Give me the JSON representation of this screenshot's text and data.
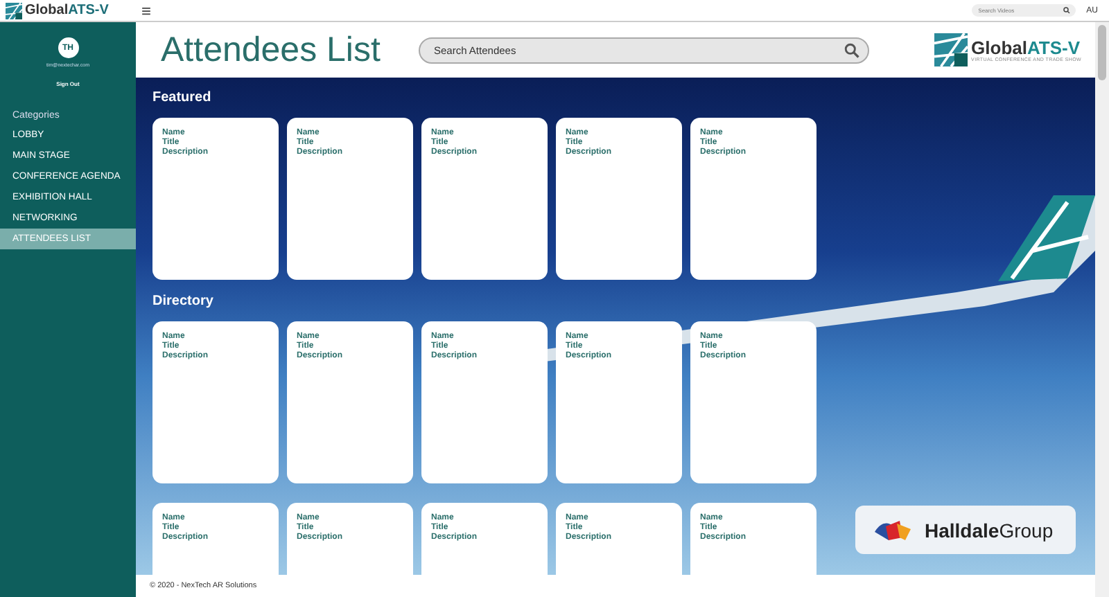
{
  "topbar": {
    "brand": {
      "word1": "Global",
      "word2": "ATS-V"
    },
    "menu_glyph": "≡",
    "search": {
      "placeholder": "Search Videos"
    },
    "user": "AU"
  },
  "sidebar": {
    "avatar": "TH",
    "email": "tim@nextechar.com",
    "sign_out": "Sign Out",
    "heading": "Categories",
    "items": [
      {
        "label": "LOBBY",
        "selected": false
      },
      {
        "label": "MAIN STAGE",
        "selected": false
      },
      {
        "label": "CONFERENCE AGENDA",
        "selected": false
      },
      {
        "label": "EXHIBITION HALL",
        "selected": false
      },
      {
        "label": "NETWORKING",
        "selected": false
      },
      {
        "label": "ATTENDEES LIST",
        "selected": true
      }
    ]
  },
  "header": {
    "title": "Attendees List",
    "search": {
      "placeholder": "Search Attendees"
    },
    "logo": {
      "word1": "Global",
      "word2": "ATS-V",
      "tagline": "VIRTUAL CONFERENCE AND TRADE SHOW"
    }
  },
  "sections": [
    {
      "heading": "Featured",
      "cards": [
        {
          "name": "Name",
          "title": "Title",
          "description": "Description"
        },
        {
          "name": "Name",
          "title": "Title",
          "description": "Description"
        },
        {
          "name": "Name",
          "title": "Title",
          "description": "Description"
        },
        {
          "name": "Name",
          "title": "Title",
          "description": "Description"
        },
        {
          "name": "Name",
          "title": "Title",
          "description": "Description"
        }
      ]
    },
    {
      "heading": "Directory",
      "cards": [
        {
          "name": "Name",
          "title": "Title",
          "description": "Description"
        },
        {
          "name": "Name",
          "title": "Title",
          "description": "Description"
        },
        {
          "name": "Name",
          "title": "Title",
          "description": "Description"
        },
        {
          "name": "Name",
          "title": "Title",
          "description": "Description"
        },
        {
          "name": "Name",
          "title": "Title",
          "description": "Description"
        },
        {
          "name": "Name",
          "title": "Title",
          "description": "Description"
        },
        {
          "name": "Name",
          "title": "Title",
          "description": "Description"
        },
        {
          "name": "Name",
          "title": "Title",
          "description": "Description"
        },
        {
          "name": "Name",
          "title": "Title",
          "description": "Description"
        },
        {
          "name": "Name",
          "title": "Title",
          "description": "Description"
        }
      ]
    }
  ],
  "sponsor": {
    "word1": "Halldale",
    "word2": "Group"
  },
  "footer": "© 2020 - NexTech AR Solutions"
}
